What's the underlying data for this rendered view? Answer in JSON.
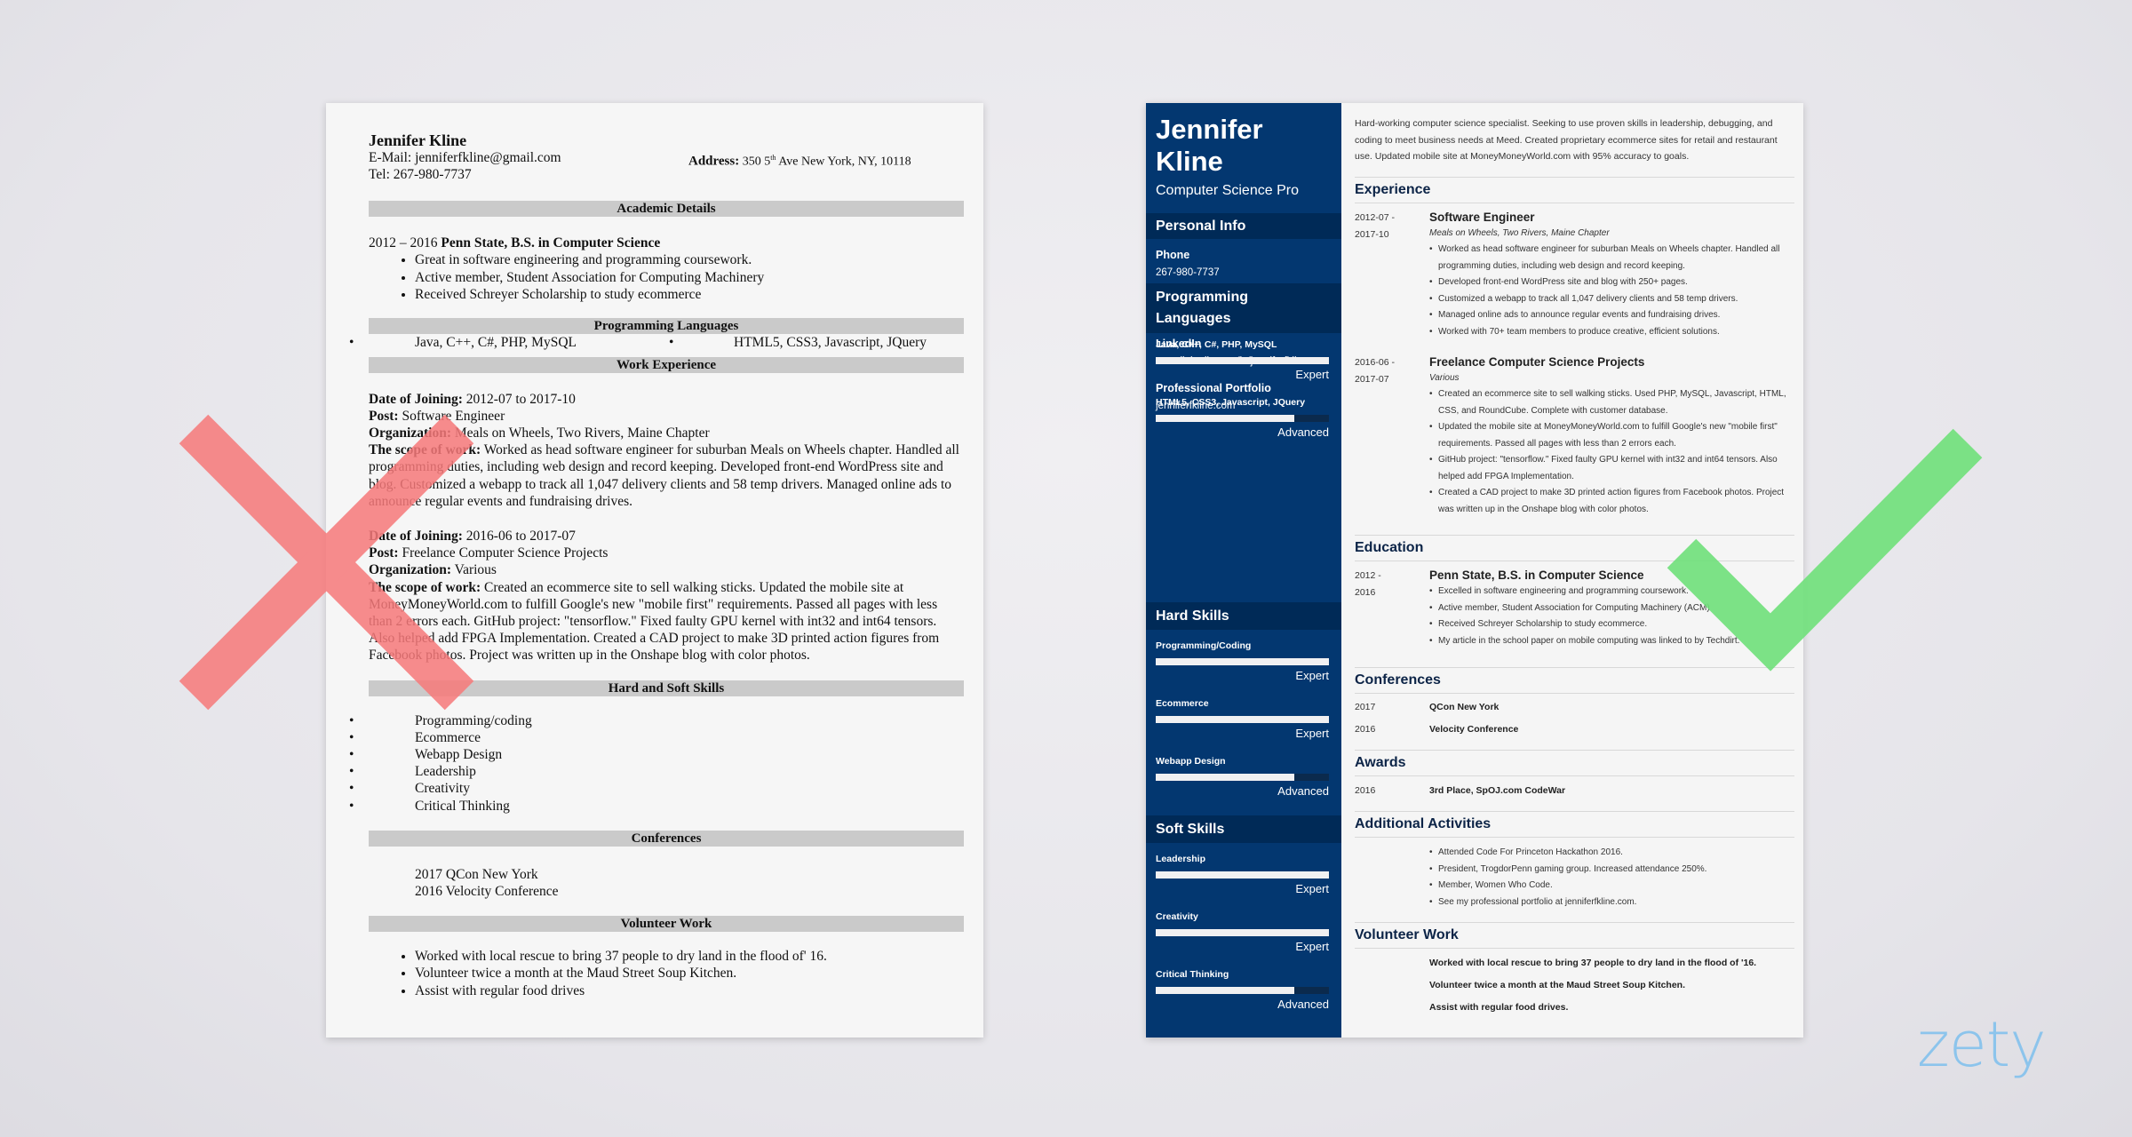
{
  "left_resume": {
    "name": "Jennifer Kline",
    "email_line": "E-Mail: jenniferfkline@gmail.com",
    "tel_line": "Tel: 267-980-7737",
    "address_label": "Address:",
    "address_pre": "350 5",
    "address_sup": "th",
    "address_post": " Ave New York, NY, 10118",
    "sections": {
      "academic": "Academic Details",
      "languages": "Programming Languages",
      "work": "Work Experience",
      "skills": "Hard and Soft Skills",
      "conferences": "Conferences",
      "volunteer": "Volunteer Work"
    },
    "education": {
      "years": "2012 – 2016",
      "degree": "Penn State, B.S. in Computer Science",
      "bullets": [
        "Great in software engineering and programming coursework.",
        "Active member, Student Association for Computing Machinery",
        "Received Schreyer Scholarship to study ecommerce"
      ]
    },
    "languages": [
      "Java, C++, C#, PHP, MySQL",
      "HTML5, CSS3, Javascript, JQuery"
    ],
    "labels": {
      "date": "Date of Joining:",
      "post": "Post:",
      "org": "Organization:",
      "scope": "The scope of work:"
    },
    "jobs": [
      {
        "date": "2012-07 to 2017-10",
        "post": "Software Engineer",
        "org": "Meals on Wheels, Two Rivers, Maine Chapter",
        "scope": "Worked as head software engineer for suburban Meals on Wheels chapter. Handled all programming duties, including web design and record keeping. Developed front-end WordPress site and blog. Customized a webapp to track all 1,047 delivery clients and 58 temp drivers. Managed online ads to announce regular events and fundraising drives."
      },
      {
        "date": "2016-06 to 2017-07",
        "post": "Freelance Computer Science Projects",
        "org": "Various",
        "scope": "Created an ecommerce site to sell walking sticks. Updated the mobile site at MoneyMoneyWorld.com to fulfill Google's new \"mobile first\" requirements. Passed all pages with less than 2 errors each. GitHub project: \"tensorflow.\" Fixed faulty GPU kernel with int32 and int64 tensors. Also helped add FPGA Implementation. Created a CAD project to make 3D printed action figures from Facebook photos. Project was written up in the Onshape blog with color photos."
      }
    ],
    "skills": [
      "Programming/coding",
      "Ecommerce",
      "Webapp Design",
      "Leadership",
      "Creativity",
      "Critical Thinking"
    ],
    "conferences": [
      "2017 QCon New York",
      "2016 Velocity Conference"
    ],
    "volunteer": [
      "Worked with local rescue to bring 37 people to dry land in the flood of' 16.",
      "Volunteer twice a month at the Maud Street Soup Kitchen.",
      "Assist with regular food drives"
    ]
  },
  "right_resume": {
    "first_name": "Jennifer",
    "last_name": "Kline",
    "title": "Computer Science Pro",
    "sidebar": {
      "personal_info_heading": "Personal Info",
      "contacts": [
        {
          "label": "Phone",
          "value": "267-980-7737"
        },
        {
          "label": "E-mail",
          "value": "jenniferfkline@gmail.com"
        },
        {
          "label": "LinkedIn",
          "value": "www.linkedin.com/in/jenniferfkline"
        },
        {
          "label": "Professional Portfolio",
          "value": "jenniferfkline.com"
        }
      ],
      "prog_heading_1": "Programming",
      "prog_heading_2": "Languages",
      "prog_langs": [
        {
          "name": "Java, C++, C#, PHP, MySQL",
          "level": "Expert",
          "fill": 1.0
        },
        {
          "name": "HTML5, CSS3, Javascript, JQuery",
          "level": "Advanced",
          "fill": 0.8
        }
      ],
      "hard_heading": "Hard Skills",
      "hard_skills": [
        {
          "name": "Programming/Coding",
          "level": "Expert",
          "fill": 1.0
        },
        {
          "name": "Ecommerce",
          "level": "Expert",
          "fill": 1.0
        },
        {
          "name": "Webapp Design",
          "level": "Advanced",
          "fill": 0.8
        }
      ],
      "soft_heading": "Soft Skills",
      "soft_skills": [
        {
          "name": "Leadership",
          "level": "Expert",
          "fill": 1.0
        },
        {
          "name": "Creativity",
          "level": "Expert",
          "fill": 1.0
        },
        {
          "name": "Critical Thinking",
          "level": "Advanced",
          "fill": 0.8
        }
      ]
    },
    "summary": "Hard-working computer science specialist. Seeking to use proven skills in leadership, debugging, and coding to meet business needs at Meed. Created proprietary ecommerce sites for retail and restaurant use. Updated mobile site at MoneyMoneyWorld.com with 95% accuracy to goals.",
    "headings": {
      "experience": "Experience",
      "education": "Education",
      "conferences": "Conferences",
      "awards": "Awards",
      "activities": "Additional Activities",
      "volunteer": "Volunteer Work"
    },
    "experience": [
      {
        "date1": "2012-07 -",
        "date2": "2017-10",
        "role": "Software Engineer",
        "org": "Meals on Wheels, Two Rivers, Maine Chapter",
        "bullets": [
          "Worked as head software engineer for suburban Meals on Wheels chapter. Handled all programming duties, including web design and record keeping.",
          "Developed front-end WordPress site and blog with 250+ pages.",
          "Customized a webapp to track all 1,047 delivery clients and 58 temp drivers.",
          "Managed online ads to announce regular events and fundraising drives.",
          "Worked with 70+ team members to produce creative, efficient solutions."
        ]
      },
      {
        "date1": "2016-06 -",
        "date2": "2017-07",
        "role": "Freelance Computer Science Projects",
        "org": "Various",
        "bullets": [
          "Created an ecommerce site to sell walking sticks. Used PHP, MySQL, Javascript, HTML, CSS, and RoundCube. Complete with customer database.",
          "Updated the mobile site at MoneyMoneyWorld.com to fulfill Google's new \"mobile first\" requirements. Passed all pages with less than 2 errors each.",
          "GitHub project: \"tensorflow.\" Fixed faulty GPU kernel with int32 and int64 tensors. Also helped add FPGA Implementation.",
          "Created a CAD project to make 3D printed action figures from Facebook photos. Project was written up in the Onshape blog with color photos."
        ]
      }
    ],
    "education": {
      "date1": "2012 -",
      "date2": "2016",
      "degree": "Penn State, B.S. in Computer Science",
      "bullets": [
        "Excelled in software engineering and programming coursework.",
        "Active member, Student Association for Computing Machinery (ACM)",
        "Received Schreyer Scholarship to study ecommerce.",
        "My article in the school paper on mobile computing was linked to by Techdirt."
      ]
    },
    "conferences": [
      {
        "year": "2017",
        "name": "QCon New York"
      },
      {
        "year": "2016",
        "name": "Velocity Conference"
      }
    ],
    "awards": [
      {
        "year": "2016",
        "name": "3rd Place, SpOJ.com CodeWar"
      }
    ],
    "activities": [
      "Attended Code For Princeton Hackathon 2016.",
      "President, TrogdorPenn gaming group. Increased attendance 250%.",
      "Member, Women Who Code.",
      "See my professional portfolio at jenniferfkline.com."
    ],
    "volunteer": [
      "Worked with local rescue to bring 37 people to dry land in the flood of '16.",
      "Volunteer twice a month at the Maud Street Soup Kitchen.",
      "Assist with regular food drives."
    ]
  },
  "marks": {
    "bad_color": "#f7797a",
    "good_color": "#6fe07a"
  },
  "brand": {
    "logo_text": "zety",
    "logo_color": "#8cc4ec",
    "sidebar_color": "#033770"
  }
}
